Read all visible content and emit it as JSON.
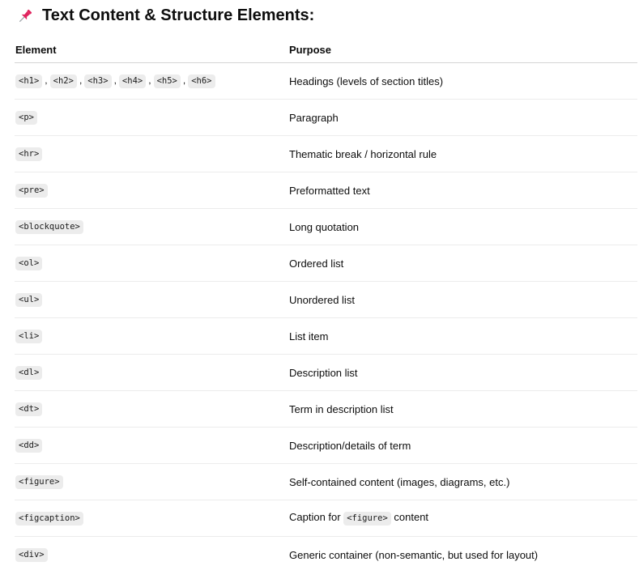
{
  "heading": {
    "icon": "pushpin-icon",
    "title": "Text Content & Structure Elements:"
  },
  "table": {
    "headers": [
      "Element",
      "Purpose"
    ],
    "rows": [
      {
        "tags": [
          "<h1>",
          "<h2>",
          "<h3>",
          "<h4>",
          "<h5>",
          "<h6>"
        ],
        "purpose": [
          "Headings (levels of section titles)"
        ]
      },
      {
        "tags": [
          "<p>"
        ],
        "purpose": [
          "Paragraph"
        ]
      },
      {
        "tags": [
          "<hr>"
        ],
        "purpose": [
          "Thematic break / horizontal rule"
        ]
      },
      {
        "tags": [
          "<pre>"
        ],
        "purpose": [
          "Preformatted text"
        ]
      },
      {
        "tags": [
          "<blockquote>"
        ],
        "purpose": [
          "Long quotation"
        ]
      },
      {
        "tags": [
          "<ol>"
        ],
        "purpose": [
          "Ordered list"
        ]
      },
      {
        "tags": [
          "<ul>"
        ],
        "purpose": [
          "Unordered list"
        ]
      },
      {
        "tags": [
          "<li>"
        ],
        "purpose": [
          "List item"
        ]
      },
      {
        "tags": [
          "<dl>"
        ],
        "purpose": [
          "Description list"
        ]
      },
      {
        "tags": [
          "<dt>"
        ],
        "purpose": [
          "Term in description list"
        ]
      },
      {
        "tags": [
          "<dd>"
        ],
        "purpose": [
          "Description/details of term"
        ]
      },
      {
        "tags": [
          "<figure>"
        ],
        "purpose": [
          "Self-contained content (images, diagrams, etc.)"
        ]
      },
      {
        "tags": [
          "<figcaption>"
        ],
        "purpose": [
          "Caption for ",
          "<figure>",
          " content"
        ]
      },
      {
        "tags": [
          "<div>"
        ],
        "purpose": [
          "Generic container (non-semantic, but used for layout)"
        ]
      }
    ]
  },
  "separator": ","
}
